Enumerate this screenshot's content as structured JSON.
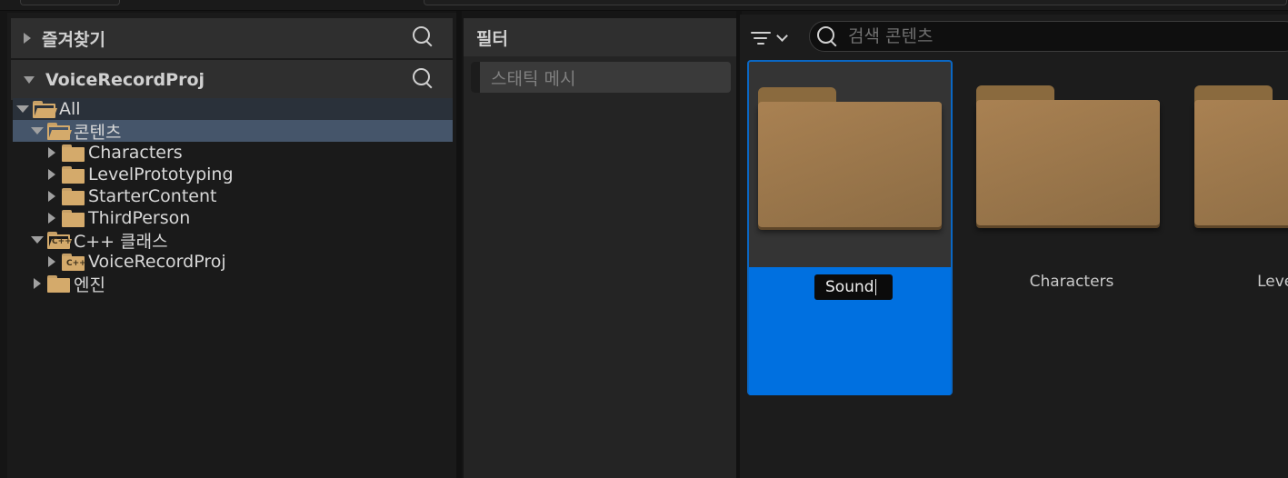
{
  "sources": {
    "favorites": {
      "title": "즐겨찾기"
    },
    "project": {
      "title": "VoiceRecordProj"
    },
    "tree": [
      {
        "label": "All",
        "level": 0,
        "expanded": true,
        "folder": "open",
        "highlight": "all"
      },
      {
        "label": "콘텐츠",
        "level": 1,
        "expanded": true,
        "folder": "open",
        "highlight": "selected"
      },
      {
        "label": "Characters",
        "level": 2,
        "expanded": false,
        "folder": "closed"
      },
      {
        "label": "LevelPrototyping",
        "level": 2,
        "expanded": false,
        "folder": "closed"
      },
      {
        "label": "StarterContent",
        "level": 2,
        "expanded": false,
        "folder": "closed"
      },
      {
        "label": "ThirdPerson",
        "level": 2,
        "expanded": false,
        "folder": "closed"
      },
      {
        "label": "C++ 클래스",
        "level": 1,
        "expanded": true,
        "folder": "open-cpp"
      },
      {
        "label": "VoiceRecordProj",
        "level": 2,
        "expanded": false,
        "folder": "closed-cpp"
      },
      {
        "label": "엔진",
        "level": 1,
        "expanded": false,
        "folder": "closed"
      }
    ]
  },
  "filters": {
    "title": "필터",
    "items": [
      {
        "label": "스태틱 메시"
      }
    ]
  },
  "content": {
    "search_placeholder": "검색 콘텐츠",
    "tiles": [
      {
        "name": "Sound",
        "renaming": true
      },
      {
        "name": "Characters",
        "renaming": false
      },
      {
        "name": "LevelPro",
        "renaming": false
      }
    ]
  },
  "colors": {
    "accent": "#0070e0",
    "folder": "#d4aa6b",
    "selected_row": "#45556a"
  },
  "icons": [
    "chevron-right-icon",
    "chevron-down-icon",
    "search-icon",
    "folder-icon",
    "folder-open-icon",
    "cpp-folder-icon",
    "filter-icon"
  ]
}
